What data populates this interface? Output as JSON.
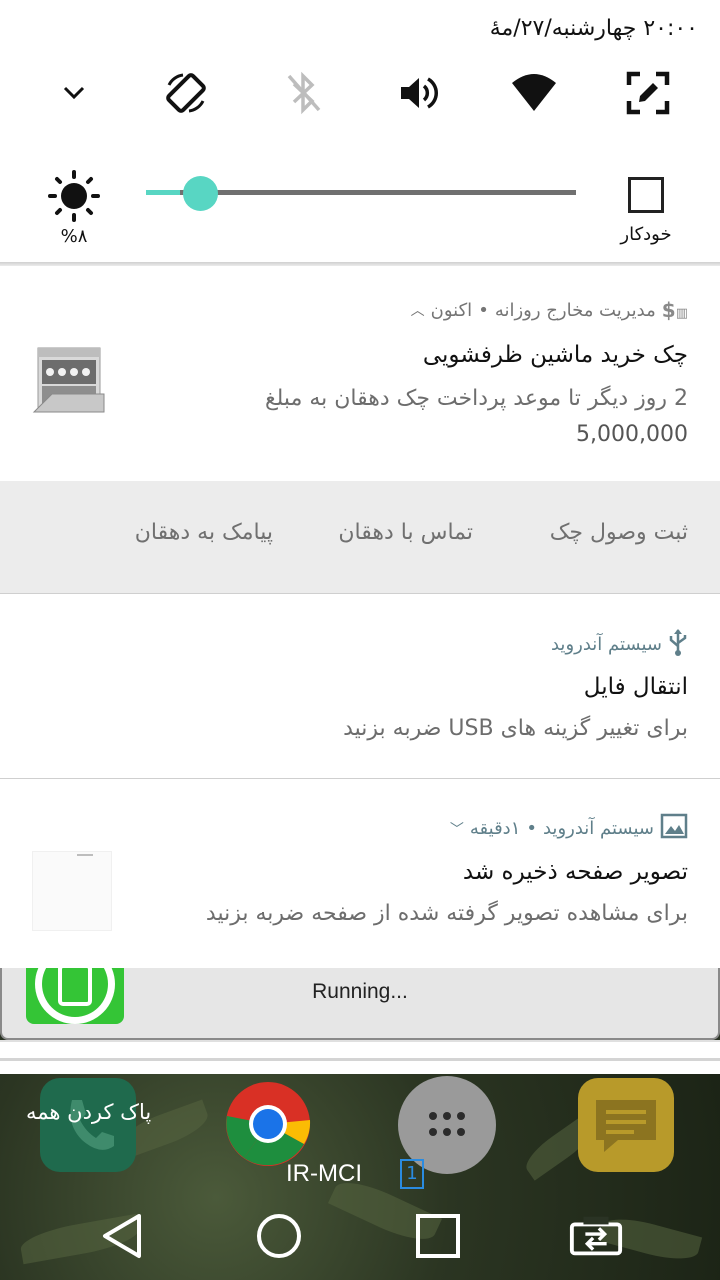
{
  "status": {
    "datetime": "۲۰:۰۰ چهارشنبه/۲۷/مهٔ"
  },
  "quick_settings": {
    "tiles": [
      "expand-icon",
      "rotate-icon",
      "bluetooth-off-icon",
      "volume-icon",
      "wifi-icon",
      "screenshot-edit-icon"
    ],
    "brightness_value": "%۸",
    "brightness_level": 0.08,
    "auto_label": "خودکار",
    "accent": "#58d6c3"
  },
  "notifications": [
    {
      "app": "مدیریت مخارج روزانه",
      "time": "اکنون",
      "title": "چک خرید ماشین ظرفشویی",
      "text": "2 روز دیگر تا موعد پرداخت چک دهقان به مبلغ",
      "amount": "5,000,000",
      "actions": [
        "ثبت وصول چک",
        "تماس با دهقان",
        "پیامک به دهقان"
      ]
    },
    {
      "app": "سیستم آندروید",
      "title": "انتقال فایل",
      "text": "برای تغییر گزینه های USB ضربه بزنید"
    },
    {
      "app": "سیستم آندروید",
      "time": "۱دقیقه",
      "title": "تصویر صفحه ذخیره شد",
      "text": "برای مشاهده تصویر گرفته شده از صفحه ضربه بزنید"
    }
  ],
  "running": {
    "label": "Running..."
  },
  "home": {
    "clear_all": "پاک کردن همه",
    "carrier": "IR-MCI",
    "sim_slot": "1"
  },
  "nav": [
    "back-icon",
    "home-icon",
    "recents-icon",
    "screen-switch-icon"
  ]
}
